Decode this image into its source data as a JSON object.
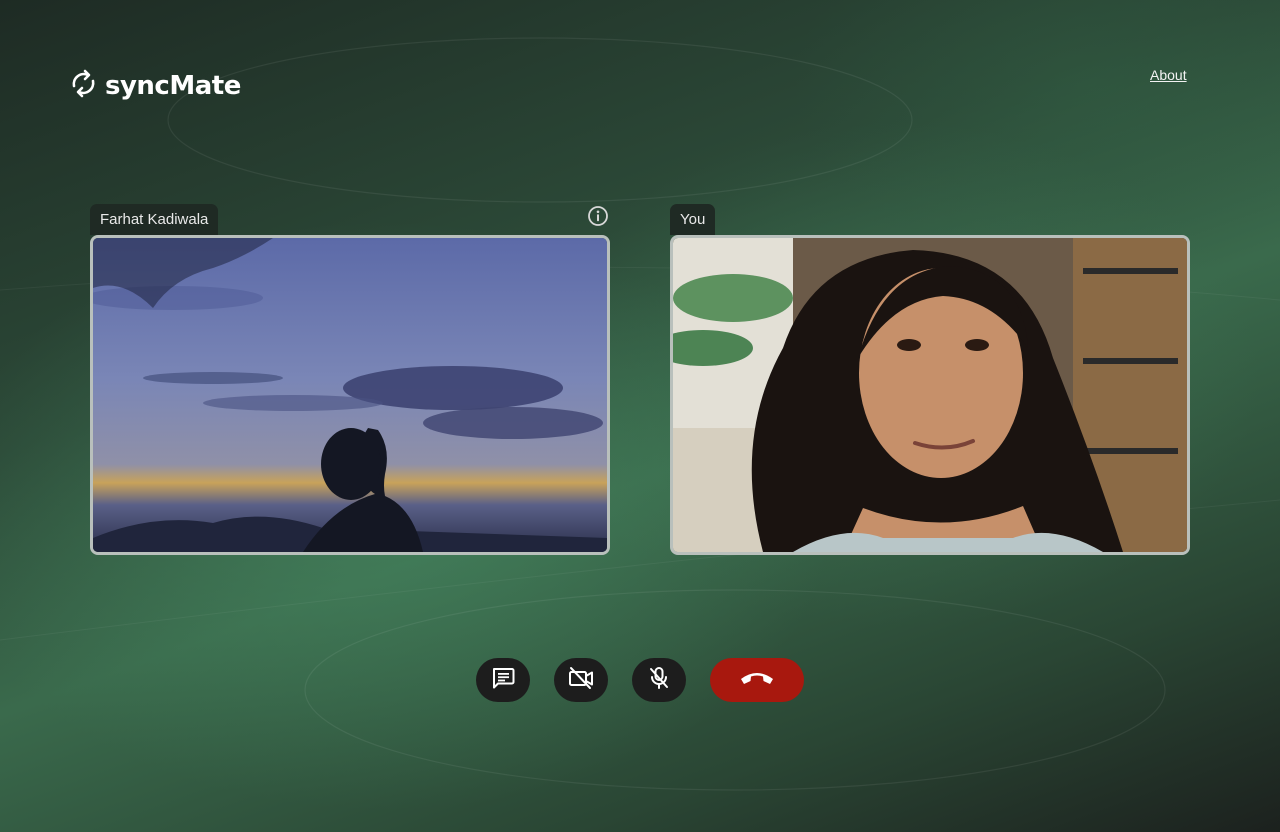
{
  "app": {
    "name": "syncMate"
  },
  "nav": {
    "about_label": "About"
  },
  "participants": [
    {
      "name": "Farhat Kadiwala",
      "video": "remote-participant-silhouette-at-dusk"
    },
    {
      "name": "You",
      "video": "self-view-camera"
    }
  ],
  "icons": {
    "logo": "sync-arrows-icon",
    "info": "info-icon",
    "chat": "chat-icon",
    "camera": "camera-off-icon",
    "mic": "mic-off-icon",
    "end_call": "phone-hangup-icon"
  },
  "colors": {
    "end_call": "#a8180e",
    "control_bg": "#1d1d1d",
    "name_tag_bg": "#1f2a24"
  }
}
